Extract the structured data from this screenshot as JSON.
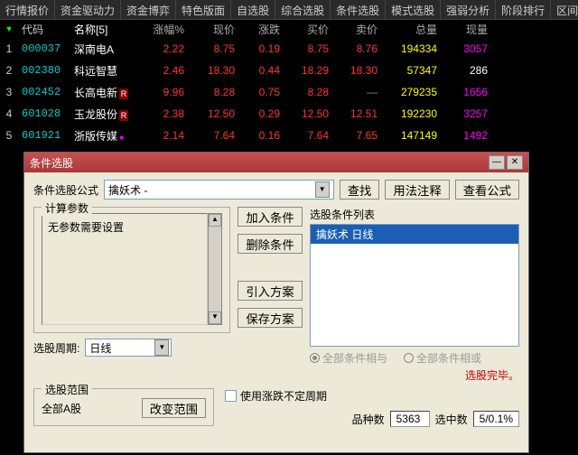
{
  "nav": {
    "tabs": [
      "行情报价",
      "资金驱动力",
      "资金博弈",
      "特色版面",
      "自选股",
      "综合选股",
      "条件选股",
      "模式选股",
      "强弱分析",
      "阶段排行",
      "区间涨"
    ]
  },
  "table": {
    "headers": {
      "code": "代码",
      "name": "名称[5]",
      "pct": "涨幅%",
      "price": "现价",
      "chg": "涨跌",
      "bid": "买价",
      "ask": "卖价",
      "vol": "总量",
      "cash": "现量"
    },
    "rows": [
      {
        "idx": "1",
        "code": "000037",
        "name": "深南电A",
        "pct": "2.22",
        "price": "8.75",
        "chg": "0.19",
        "bid": "8.75",
        "ask": "8.76",
        "vol": "194334",
        "cash": "3057",
        "flag": ""
      },
      {
        "idx": "2",
        "code": "002380",
        "name": "科远智慧",
        "pct": "2.46",
        "price": "18.30",
        "chg": "0.44",
        "bid": "18.29",
        "ask": "18.30",
        "vol": "57347",
        "cash": "286",
        "flag": ""
      },
      {
        "idx": "3",
        "code": "002452",
        "name": "长高电新",
        "pct": "9.96",
        "price": "8.28",
        "chg": "0.75",
        "bid": "8.28",
        "ask": "—",
        "vol": "279235",
        "cash": "1656",
        "flag": "R"
      },
      {
        "idx": "4",
        "code": "601028",
        "name": "玉龙股份",
        "pct": "2.38",
        "price": "12.50",
        "chg": "0.29",
        "bid": "12.50",
        "ask": "12.51",
        "vol": "192230",
        "cash": "3257",
        "flag": "R"
      },
      {
        "idx": "5",
        "code": "601921",
        "name": "浙版传媒",
        "pct": "2.14",
        "price": "7.64",
        "chg": "0.16",
        "bid": "7.64",
        "ask": "7.65",
        "vol": "147149",
        "cash": "1492",
        "flag": "●"
      }
    ]
  },
  "dialog": {
    "title": "条件选股",
    "formula_label": "条件选股公式",
    "formula_value": "擒妖术  -",
    "find": "查找",
    "usage": "用法注释",
    "view": "查看公式",
    "params_legend": "计算参数",
    "params_text": "无参数需要设置",
    "add": "加入条件",
    "del": "删除条件",
    "import": "引入方案",
    "save": "保存方案",
    "list_label": "选股条件列表",
    "list_item": "擒妖术  日线",
    "radio_and": "全部条件相与",
    "radio_or": "全部条件相或",
    "done": "选股完毕。",
    "period_label": "选股周期:",
    "period_value": "日线",
    "scope_legend": "选股范围",
    "scope_text": "全部A股",
    "change_scope": "改变范围",
    "chk_label": "使用涨跌不定周期",
    "count_label": "品种数",
    "count_value": "5363",
    "sel_label": "选中数",
    "sel_value": "5/0.1%"
  }
}
